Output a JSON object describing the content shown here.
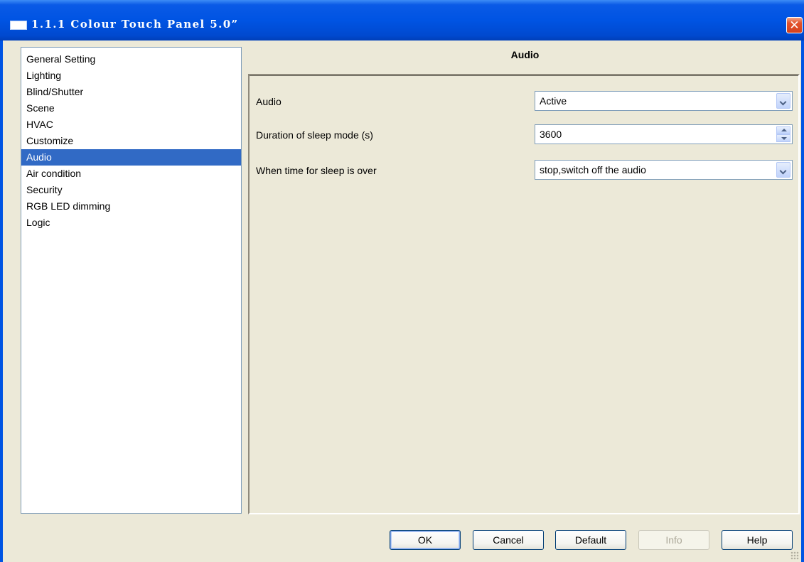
{
  "window": {
    "title": "1.1.1 Colour Touch Panel 5.0”",
    "close_label": "✕"
  },
  "sidebar": {
    "items": [
      {
        "label": "General Setting"
      },
      {
        "label": "Lighting"
      },
      {
        "label": "Blind/Shutter"
      },
      {
        "label": "Scene"
      },
      {
        "label": "HVAC"
      },
      {
        "label": "Customize"
      },
      {
        "label": "Audio",
        "selected": true
      },
      {
        "label": "Air condition"
      },
      {
        "label": "Security"
      },
      {
        "label": "RGB LED dimming"
      },
      {
        "label": "Logic"
      }
    ]
  },
  "panel": {
    "title": "Audio",
    "params": [
      {
        "label": "Audio",
        "value": "Active",
        "control": "dropdown"
      },
      {
        "label": "Duration of sleep mode (s)",
        "value": "3600",
        "control": "spinner"
      },
      {
        "label": "When time for sleep is over",
        "value": "stop,switch off the audio",
        "control": "dropdown"
      }
    ]
  },
  "buttons": {
    "ok": "OK",
    "cancel": "Cancel",
    "default": "Default",
    "info": "Info",
    "help": "Help"
  },
  "colors": {
    "title_bar": "#0054e3",
    "selection": "#316ac5",
    "background": "#ece9d8",
    "close_button": "#e3532c"
  }
}
